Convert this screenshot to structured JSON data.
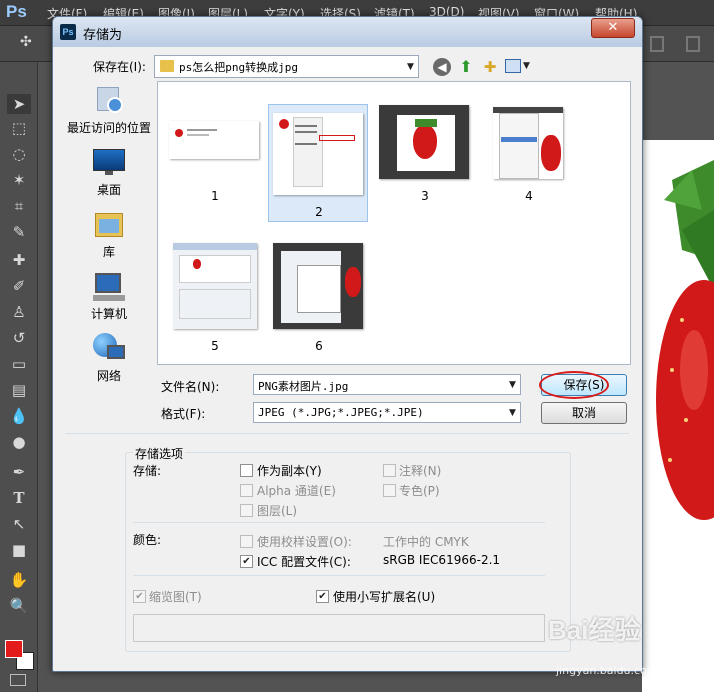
{
  "photoshop": {
    "logo": "Ps",
    "menus": [
      "文件(F)",
      "编辑(E)",
      "图像(I)",
      "图层(L)",
      "文字(Y)",
      "选择(S)",
      "滤镜(T)",
      "3D(D)",
      "视图(V)",
      "窗口(W)",
      "帮助(H)"
    ],
    "colors": {
      "foreground": "#e31b1b",
      "background": "#ffffff"
    }
  },
  "dialog": {
    "title": "存储为",
    "close_label": "✕",
    "save_in_label": "保存在(I):",
    "save_in_value": "ps怎么把png转换成jpg",
    "places": [
      {
        "label": "最近访问的位置",
        "icon": "recent-places-icon"
      },
      {
        "label": "桌面",
        "icon": "desktop-icon"
      },
      {
        "label": "库",
        "icon": "libraries-icon"
      },
      {
        "label": "计算机",
        "icon": "computer-icon"
      },
      {
        "label": "网络",
        "icon": "network-icon"
      }
    ],
    "files": [
      {
        "name": "1",
        "selected": false
      },
      {
        "name": "2",
        "selected": true
      },
      {
        "name": "3",
        "selected": false
      },
      {
        "name": "4",
        "selected": false
      },
      {
        "name": "5",
        "selected": false
      },
      {
        "name": "6",
        "selected": false
      }
    ],
    "filename_label": "文件名(N):",
    "filename_value": "PNG素材图片.jpg",
    "format_label": "格式(F):",
    "format_value": "JPEG (*.JPG;*.JPEG;*.JPE)",
    "save_button": "保存(S)",
    "cancel_button": "取消",
    "options": {
      "group_title": "存储选项",
      "storage_label": "存储:",
      "as_copy": {
        "label": "作为副本(Y)",
        "checked": false,
        "enabled": true
      },
      "notes": {
        "label": "注释(N)",
        "checked": false,
        "enabled": false
      },
      "alpha": {
        "label": "Alpha 通道(E)",
        "checked": false,
        "enabled": false
      },
      "spot": {
        "label": "专色(P)",
        "checked": false,
        "enabled": false
      },
      "layers": {
        "label": "图层(L)",
        "checked": false,
        "enabled": false
      },
      "color_label": "颜色:",
      "proof": {
        "label": "使用校样设置(O):",
        "value": "工作中的 CMYK",
        "checked": false,
        "enabled": false
      },
      "icc": {
        "label": "ICC 配置文件(C):",
        "value": "sRGB IEC61966-2.1",
        "checked": true,
        "enabled": true
      },
      "thumbnail": {
        "label": "缩览图(T)",
        "checked": true,
        "enabled": false
      },
      "lowercase": {
        "label": "使用小写扩展名(U)",
        "checked": true,
        "enabled": true
      }
    }
  },
  "watermark": {
    "text": "Bai经验",
    "url": "jingyan.baidu.com"
  }
}
